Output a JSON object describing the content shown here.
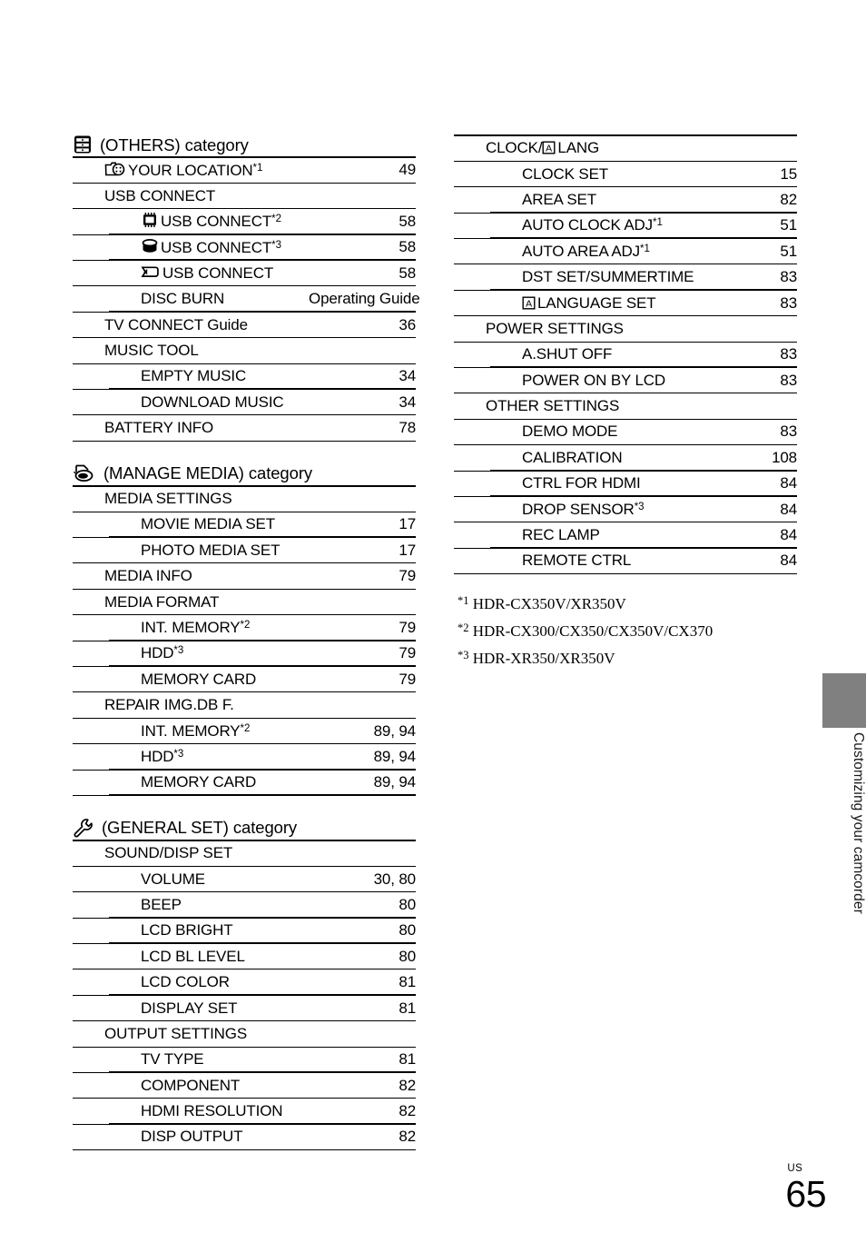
{
  "page": {
    "number": "65",
    "region_label": "US",
    "side_tab_text": "Customizing your camcorder",
    "tab_color": "#808080"
  },
  "left_column": [
    {
      "heading": {
        "icon": "others-category-icon",
        "label": "(OTHERS) category"
      },
      "rows": [
        {
          "level": 1,
          "icon": "your-location-icon",
          "label": "YOUR LOCATION",
          "sup": "*1",
          "page": "49"
        },
        {
          "level": 1,
          "icon": null,
          "label": "USB CONNECT",
          "sup": "",
          "page": ""
        },
        {
          "level": 2,
          "icon": "internal-memory-icon",
          "label": "USB CONNECT",
          "sup": "*2",
          "page": "58"
        },
        {
          "level": 2,
          "icon": "hdd-icon",
          "label": "USB CONNECT",
          "sup": "*3",
          "page": "58"
        },
        {
          "level": 2,
          "icon": "memory-card-icon",
          "label": "USB CONNECT",
          "sup": "",
          "page": "58"
        },
        {
          "level": 2,
          "icon": null,
          "label": "DISC BURN",
          "sup": "",
          "page": "Operating Guide"
        },
        {
          "level": 1,
          "icon": null,
          "label": "TV CONNECT Guide",
          "sup": "",
          "page": "36"
        },
        {
          "level": 1,
          "icon": null,
          "label": "MUSIC TOOL",
          "sup": "",
          "page": ""
        },
        {
          "level": 2,
          "icon": null,
          "label": "EMPTY MUSIC",
          "sup": "",
          "page": "34"
        },
        {
          "level": 2,
          "icon": null,
          "label": "DOWNLOAD MUSIC",
          "sup": "",
          "page": "34"
        },
        {
          "level": 1,
          "icon": null,
          "label": "BATTERY INFO",
          "sup": "",
          "page": "78"
        }
      ]
    },
    {
      "heading": {
        "icon": "manage-media-category-icon",
        "label": "(MANAGE MEDIA) category"
      },
      "rows": [
        {
          "level": 1,
          "icon": null,
          "label": "MEDIA SETTINGS",
          "sup": "",
          "page": ""
        },
        {
          "level": 2,
          "icon": null,
          "label": "MOVIE MEDIA SET",
          "sup": "",
          "page": "17"
        },
        {
          "level": 2,
          "icon": null,
          "label": "PHOTO MEDIA SET",
          "sup": "",
          "page": "17"
        },
        {
          "level": 1,
          "icon": null,
          "label": "MEDIA INFO",
          "sup": "",
          "page": "79"
        },
        {
          "level": 1,
          "icon": null,
          "label": "MEDIA FORMAT",
          "sup": "",
          "page": ""
        },
        {
          "level": 2,
          "icon": null,
          "label": "INT. MEMORY",
          "sup": "*2",
          "page": "79"
        },
        {
          "level": 2,
          "icon": null,
          "label": "HDD",
          "sup": "*3",
          "page": "79"
        },
        {
          "level": 2,
          "icon": null,
          "label": "MEMORY CARD",
          "sup": "",
          "page": "79"
        },
        {
          "level": 1,
          "icon": null,
          "label": "REPAIR IMG.DB F.",
          "sup": "",
          "page": ""
        },
        {
          "level": 2,
          "icon": null,
          "label": "INT. MEMORY",
          "sup": "*2",
          "page": "89, 94"
        },
        {
          "level": 2,
          "icon": null,
          "label": "HDD",
          "sup": "*3",
          "page": "89, 94"
        },
        {
          "level": 2,
          "icon": null,
          "label": "MEMORY CARD",
          "sup": "",
          "page": "89, 94"
        }
      ]
    },
    {
      "heading": {
        "icon": "general-set-category-icon",
        "label": "(GENERAL SET) category"
      },
      "rows": [
        {
          "level": 1,
          "icon": null,
          "label": "SOUND/DISP SET",
          "sup": "",
          "page": ""
        },
        {
          "level": 2,
          "icon": null,
          "label": "VOLUME",
          "sup": "",
          "page": "30, 80"
        },
        {
          "level": 2,
          "icon": null,
          "label": "BEEP",
          "sup": "",
          "page": "80"
        },
        {
          "level": 2,
          "icon": null,
          "label": "LCD BRIGHT",
          "sup": "",
          "page": "80"
        },
        {
          "level": 2,
          "icon": null,
          "label": "LCD BL LEVEL",
          "sup": "",
          "page": "80"
        },
        {
          "level": 2,
          "icon": null,
          "label": "LCD COLOR",
          "sup": "",
          "page": "81"
        },
        {
          "level": 2,
          "icon": null,
          "label": "DISPLAY SET",
          "sup": "",
          "page": "81"
        },
        {
          "level": 1,
          "icon": null,
          "label": "OUTPUT SETTINGS",
          "sup": "",
          "page": ""
        },
        {
          "level": 2,
          "icon": null,
          "label": "TV TYPE",
          "sup": "",
          "page": "81"
        },
        {
          "level": 2,
          "icon": null,
          "label": "COMPONENT",
          "sup": "",
          "page": "82"
        },
        {
          "level": 2,
          "icon": null,
          "label": "HDMI RESOLUTION",
          "sup": "",
          "page": "82"
        },
        {
          "level": 2,
          "icon": null,
          "label": "DISP OUTPUT",
          "sup": "",
          "page": "82"
        }
      ]
    }
  ],
  "right_column": [
    {
      "heading": null,
      "rows": [
        {
          "level": 1,
          "icon": null,
          "pre_label": "CLOCK/",
          "icon_mid": "language-a-icon",
          "label": "LANG",
          "sup": "",
          "page": ""
        },
        {
          "level": 2,
          "icon": null,
          "label": "CLOCK SET",
          "sup": "",
          "page": "15"
        },
        {
          "level": 2,
          "icon": null,
          "label": "AREA SET",
          "sup": "",
          "page": "82"
        },
        {
          "level": 2,
          "icon": null,
          "label": "AUTO CLOCK ADJ",
          "sup": "*1",
          "page": "51"
        },
        {
          "level": 2,
          "icon": null,
          "label": "AUTO AREA ADJ",
          "sup": "*1",
          "page": "51"
        },
        {
          "level": 2,
          "icon": null,
          "label": "DST SET/SUMMERTIME",
          "sup": "",
          "page": "83"
        },
        {
          "level": 2,
          "icon": "language-a-icon",
          "label": "LANGUAGE SET",
          "sup": "",
          "page": "83"
        },
        {
          "level": 1,
          "icon": null,
          "label": "POWER SETTINGS",
          "sup": "",
          "page": ""
        },
        {
          "level": 2,
          "icon": null,
          "label": "A.SHUT OFF",
          "sup": "",
          "page": "83"
        },
        {
          "level": 2,
          "icon": null,
          "label": "POWER ON BY LCD",
          "sup": "",
          "page": "83"
        },
        {
          "level": 1,
          "icon": null,
          "label": "OTHER SETTINGS",
          "sup": "",
          "page": ""
        },
        {
          "level": 2,
          "icon": null,
          "label": "DEMO MODE",
          "sup": "",
          "page": "83"
        },
        {
          "level": 2,
          "icon": null,
          "label": "CALIBRATION",
          "sup": "",
          "page": "108"
        },
        {
          "level": 2,
          "icon": null,
          "label": "CTRL FOR HDMI",
          "sup": "",
          "page": "84"
        },
        {
          "level": 2,
          "icon": null,
          "label": "DROP SENSOR",
          "sup": "*3",
          "page": "84"
        },
        {
          "level": 2,
          "icon": null,
          "label": "REC LAMP",
          "sup": "",
          "page": "84"
        },
        {
          "level": 2,
          "icon": null,
          "label": "REMOTE CTRL",
          "sup": "",
          "page": "84"
        }
      ]
    }
  ],
  "footnotes": [
    {
      "mark": "*1",
      "text": "HDR-CX350V/XR350V"
    },
    {
      "mark": "*2",
      "text": "HDR-CX300/CX350/CX350V/CX370"
    },
    {
      "mark": "*3",
      "text": "HDR-XR350/XR350V"
    }
  ]
}
